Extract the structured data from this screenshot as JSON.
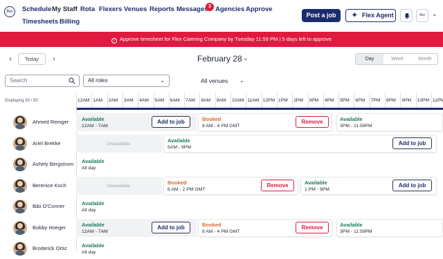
{
  "header": {
    "logo_text": "flex",
    "nav": [
      "Schedule",
      "My Staff",
      "Rota",
      "Flexers",
      "Venues",
      "Reports",
      "Messages",
      "Agencies",
      "Approve",
      "Timesheets",
      "Billing"
    ],
    "messages_badge": "3",
    "post_job_label": "Post a job",
    "flex_agent_label": "Flex Agent",
    "account_logo_text": "flex"
  },
  "banner": {
    "text": "Approve timesheet for Flex Catering Company by Tuesday 11:59 PM | 5 days left to approve",
    "color": "#e0193f"
  },
  "toolbar": {
    "prev": "‹",
    "today": "Today",
    "next": "›",
    "date": "February 28",
    "views": [
      "Day",
      "Week",
      "Month"
    ],
    "active_view": "Day"
  },
  "filters": {
    "search_placeholder": "Search",
    "roles": "All roles",
    "venues": "All venues"
  },
  "displaying": "Displaying 50 / 50",
  "hours": [
    "12AM",
    "1AM",
    "2AM",
    "3AM",
    "4AM",
    "5AM",
    "6AM",
    "7AM",
    "8AM",
    "9AM",
    "10AM",
    "11AM",
    "12PM",
    "1PM",
    "2PM",
    "3PM",
    "4PM",
    "5PM",
    "6PM",
    "7PM",
    "8PM",
    "9PM",
    "10PM",
    "11PM"
  ],
  "colors": {
    "navy": "#1a2c6e",
    "available": "#1b7a5a",
    "booked": "#e0662a",
    "remove": "#e0193f"
  },
  "labels": {
    "add_to_job": "Add to job",
    "remove": "Remove",
    "unavailable": "Unavailable",
    "available": "Available",
    "booked": "Booked",
    "all_day": "All day"
  },
  "staff": [
    {
      "name": "Ahmed Reinger",
      "blocks": [
        {
          "kind": "available",
          "time": "12AM - 7AM",
          "action": "add"
        },
        {
          "kind": "booked",
          "time": "8 AM - 4 PM GMT",
          "action": "remove"
        },
        {
          "kind": "available",
          "time": "3PM - 11:59PM"
        }
      ]
    },
    {
      "name": "Ariel Brekke",
      "blocks": [
        {
          "kind": "unavailable"
        },
        {
          "kind": "available",
          "time": "5AM - 9PM",
          "action": "add"
        }
      ]
    },
    {
      "name": "Ashely Bergstrom",
      "blocks": [
        {
          "kind": "available",
          "time": "All day"
        }
      ]
    },
    {
      "name": "Berenice Koch",
      "blocks": [
        {
          "kind": "unavailable"
        },
        {
          "kind": "booked",
          "time": "6 AM - 2 PM GMT",
          "action": "remove"
        },
        {
          "kind": "available",
          "time": "1 PM - 9PM",
          "action": "add"
        }
      ]
    },
    {
      "name": "Bibi O'Conner",
      "blocks": [
        {
          "kind": "available",
          "time": "All day"
        }
      ]
    },
    {
      "name": "Bobby Hoeger",
      "blocks": [
        {
          "kind": "available",
          "time": "12AM - 7AM",
          "action": "add"
        },
        {
          "kind": "booked",
          "time": "8 AM - 4 PM GMT",
          "action": "remove"
        },
        {
          "kind": "available",
          "time": "3PM - 11:59PM"
        }
      ]
    },
    {
      "name": "Broderick Ortiz",
      "blocks": [
        {
          "kind": "available",
          "time": "All day"
        }
      ]
    }
  ]
}
